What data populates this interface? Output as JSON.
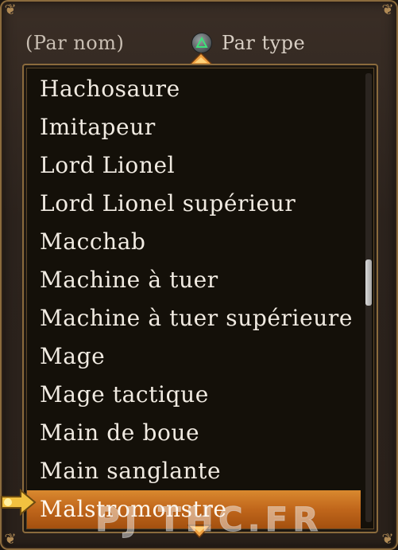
{
  "sort": {
    "by_name_label": "(Par nom)",
    "by_type_label": "Par type",
    "button_icon": "triangle-button-icon"
  },
  "list": {
    "items": [
      "Hachosaure",
      "Imitapeur",
      "Lord Lionel",
      "Lord Lionel supérieur",
      "Macchab",
      "Machine à tuer",
      "Machine à tuer supérieure",
      "Mage",
      "Mage tactique",
      "Main de boue",
      "Main sanglante",
      "Malstromonstre"
    ],
    "selected_index": 11,
    "scroll_position_fraction": 0.45
  },
  "watermark": "PJ THC.FR",
  "colors": {
    "selection": "#c0661b",
    "frame_border": "#8b6b3d",
    "text": "#f1ebe2"
  }
}
